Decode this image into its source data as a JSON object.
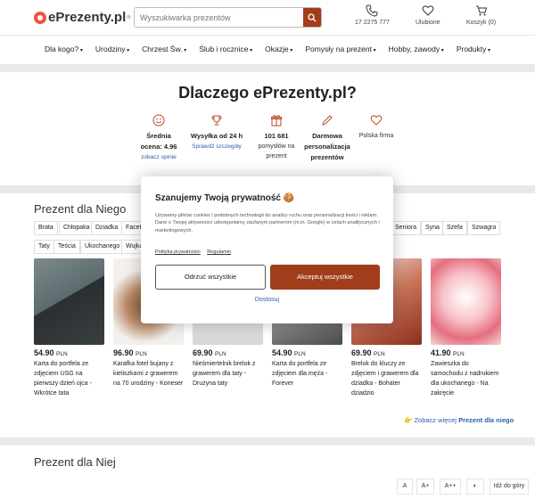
{
  "header": {
    "logo_text": "ePrezenty.pl",
    "logo_reg": "®",
    "search_placeholder": "Wyszukiwarka prezentów",
    "phone": "17 2275 777",
    "favorites": "Ulubione",
    "cart": "Koszyk (0)"
  },
  "nav": [
    "Dla kogo?",
    "Urodziny",
    "Chrzest Św.",
    "Ślub i rocznice",
    "Okazje",
    "Pomysły na prezent",
    "Hobby, zawody",
    "Produkty"
  ],
  "why": {
    "title": "Dlaczego ePrezenty.pl?",
    "items": [
      {
        "line1": "Średnia",
        "line2": "ocena: 4.96",
        "link": "zobacz opinie"
      },
      {
        "line1": "Wysyłka od 24 h",
        "link": "Sprawdź szczegóły"
      },
      {
        "line1": "101 681",
        "line2": "pomysłów na",
        "line3": "prezent"
      },
      {
        "line1": "Darmowa",
        "line2": "personalizacja",
        "line3": "prezentów"
      },
      {
        "line1": "Polska firma"
      }
    ]
  },
  "section_him": {
    "title": "Prezent dla Niego",
    "chips_row1": [
      "Brata",
      "Chłopaka",
      "Dziadka",
      "Faceta",
      "Seniora",
      "Syna",
      "Szefa",
      "Szwagra"
    ],
    "chips_row2": [
      "Taty",
      "Teścia",
      "Ukochanego",
      "Wujka"
    ],
    "products": [
      {
        "price": "54.90",
        "currency": "PLN",
        "name": "Karta do portfela ze zdjęciem USG na pierwszy dzień ojca - Wkrótce tata"
      },
      {
        "price": "96.90",
        "currency": "PLN",
        "name": "Karafka fotel bujany z kieliszkami z grawerem na 70 urodziny - Koneser"
      },
      {
        "price": "69.90",
        "currency": "PLN",
        "name": "Nieśmiertelnik brelok z grawerem dla taty - Drużyna taty"
      },
      {
        "price": "54.90",
        "currency": "PLN",
        "name": "Karta do portfela ze zdjęciem dla męża - Forever"
      },
      {
        "price": "69.90",
        "currency": "PLN",
        "name": "Brelok do kluczy ze zdjęciem i grawerem dla dziadka - Bohater dziadzio"
      },
      {
        "price": "41.90",
        "currency": "PLN",
        "name": "Zawieszka do samochodu z nadrukiem dla ukochanego - Na zakręcie"
      }
    ],
    "more_prefix": "Zobacz więcej",
    "more_bold": "Prezent dla niego"
  },
  "section_her": {
    "title": "Prezent dla Niej"
  },
  "toolbar": {
    "a": "A",
    "a_plus": "A+",
    "a_plus_plus": "A++",
    "contrast": "◐",
    "top": "Idź do góry"
  },
  "cookie": {
    "title": "Szanujemy Twoją prywatność 🍪",
    "text": "Używamy plików cookies i podobnych technologii do analizy ruchu oraz personalizacji treści i reklam. Dane o Twojej aktywności udostępniamy zaufanym partnerom (m.in. Google) w celach analitycznych i marketingowych.",
    "link_privacy": "Polityka prywatności",
    "link_rules": "Regulamin",
    "reject": "Odrzuć wszystkie",
    "accept": "Akceptuj wszystkie",
    "settings": "Dostosuj"
  },
  "colors": {
    "accent": "#a13d1b",
    "link": "#2b62a8",
    "logo": "#e8573c"
  }
}
